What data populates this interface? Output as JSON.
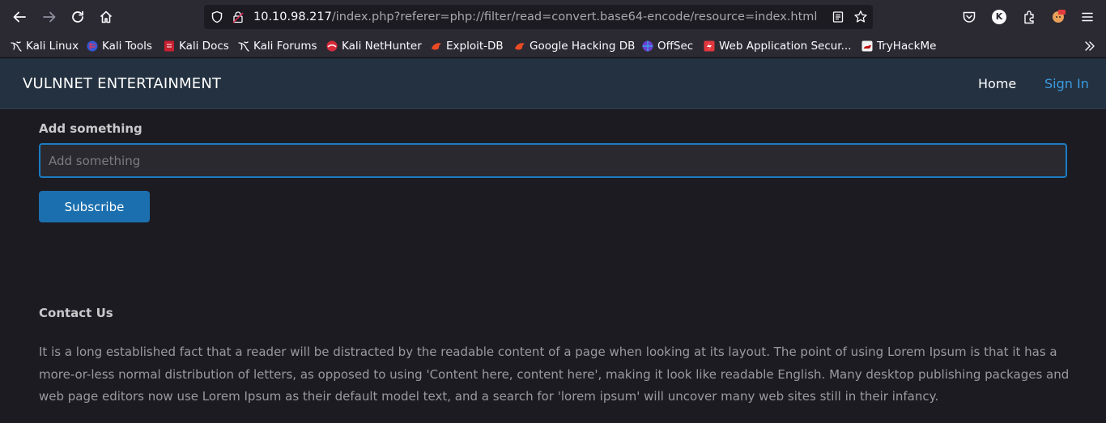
{
  "browser": {
    "url_host": "10.10.98.217",
    "url_path": "/index.php?referer=php://filter/read=convert.base64-encode/resource=index.html",
    "account_initial": "K"
  },
  "bookmarks": [
    {
      "label": "Kali Linux",
      "icon": "kali-dragon-icon"
    },
    {
      "label": "Kali Tools",
      "icon": "kali-tools-icon"
    },
    {
      "label": "Kali Docs",
      "icon": "kali-docs-icon"
    },
    {
      "label": "Kali Forums",
      "icon": "kali-dragon-icon"
    },
    {
      "label": "Kali NetHunter",
      "icon": "nethunter-icon"
    },
    {
      "label": "Exploit-DB",
      "icon": "exploit-db-icon"
    },
    {
      "label": "Google Hacking DB",
      "icon": "ghdb-icon"
    },
    {
      "label": "OffSec",
      "icon": "offsec-icon"
    },
    {
      "label": "Web Application Secur...",
      "icon": "portswigger-icon"
    },
    {
      "label": "TryHackMe",
      "icon": "tryhackme-icon"
    }
  ],
  "site": {
    "brand": "VULNNET ENTERTAINMENT",
    "nav_home": "Home",
    "nav_signin": "Sign In"
  },
  "form": {
    "label": "Add something",
    "placeholder": "Add something",
    "button": "Subscribe"
  },
  "contact": {
    "title": "Contact Us",
    "text": "It is a long established fact that a reader will be distracted by the readable content of a page when looking at its layout. The point of using Lorem Ipsum is that it has a more-or-less normal distribution of letters, as opposed to using 'Content here, content here', making it look like readable English. Many desktop publishing packages and web page editors now use Lorem Ipsum as their default model text, and a search for 'lorem ipsum' will uncover many web sites still in their infancy."
  },
  "colors": {
    "accent": "#1b7cc1",
    "signin": "#3b9be0",
    "header_bg": "#233140"
  }
}
